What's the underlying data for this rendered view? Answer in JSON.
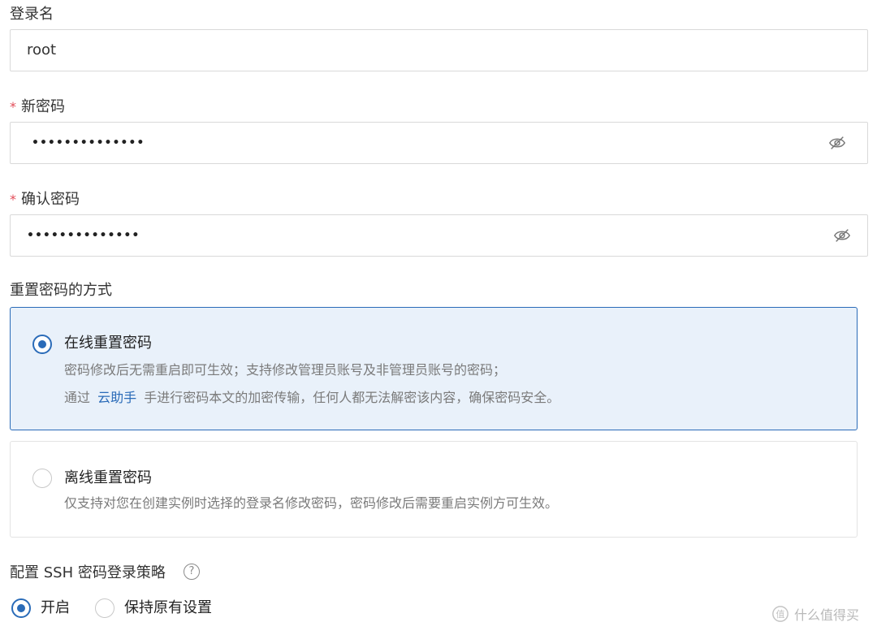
{
  "login": {
    "label": "登录名",
    "value": "root"
  },
  "new_password": {
    "required_mark": "*",
    "label": "新密码",
    "masked_value": "••••••••••••••"
  },
  "confirm_password": {
    "required_mark": "*",
    "label": "确认密码",
    "masked_value": "••••••••••••••"
  },
  "reset_method": {
    "label": "重置密码的方式",
    "online": {
      "title": "在线重置密码",
      "desc_line1": "密码修改后无需重启即可生效；支持修改管理员账号及非管理员账号的密码；",
      "desc_line2_prefix": "通过",
      "desc_line2_link": "云助手",
      "desc_line2_suffix": "手进行密码本文的加密传输，任何人都无法解密该内容，确保密码安全。",
      "selected": true
    },
    "offline": {
      "title": "离线重置密码",
      "desc": "仅支持对您在创建实例时选择的登录名修改密码，密码修改后需要重启实例方可生效。",
      "selected": false
    }
  },
  "ssh_policy": {
    "label": "配置 SSH 密码登录策略",
    "help_icon": "?",
    "options": [
      {
        "label": "开启",
        "selected": true
      },
      {
        "label": "保持原有设置",
        "selected": false
      }
    ]
  },
  "watermark": {
    "text": "什么值得买"
  },
  "colors": {
    "accent": "#2a6bb8",
    "required": "#e34d59",
    "selected_bg": "#e9f1fa"
  }
}
